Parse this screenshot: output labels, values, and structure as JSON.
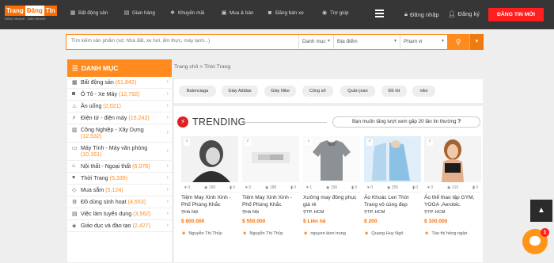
{
  "logo": {
    "part1": "Trang",
    "part2": "Đăng",
    "part3": "Tin",
    "tagline": "ĐĂNG NHANH - BÁN NHANH"
  },
  "nav": [
    {
      "label": "Bất động sản",
      "icon": "building-icon"
    },
    {
      "label": "Gian hàng",
      "icon": "store-icon"
    },
    {
      "label": "Khuyến mãi",
      "icon": "gift-icon"
    },
    {
      "label": "Mua & bán",
      "icon": "cart-icon"
    },
    {
      "label": "Đăng bán xe",
      "icon": "car-icon"
    },
    {
      "label": "Trợ giúp",
      "icon": "help-icon"
    }
  ],
  "account": {
    "login": "Đăng nhập",
    "register": "Đăng ký",
    "post_button": "ĐĂNG TIN MỚI"
  },
  "search": {
    "placeholder": "Tìm kiếm sản phẩm (vd: Nhà đất, xe hơi, ẩm thực, máy lạnh...)",
    "category": "Danh mục",
    "location": "Địa điểm",
    "range": "Phạm vi"
  },
  "sidebar": {
    "title": "DANH MỤC",
    "items": [
      {
        "label": "Bất động sản",
        "count": "(61,842)"
      },
      {
        "label": "Ô Tô - Xe Máy",
        "count": "(12,792)"
      },
      {
        "label": "Ăn uống",
        "count": "(2,021)"
      },
      {
        "label": "Điện tử - điện máy",
        "count": "(15,242)"
      },
      {
        "label": "Công Nghiệp - Xây Dựng",
        "count": "(12,532)"
      },
      {
        "label": "Máy Tính - Máy văn phòng",
        "count": "(10,161)"
      },
      {
        "label": "Nội thất - Ngoại thất",
        "count": "(6,076)"
      },
      {
        "label": "Thời Trang",
        "count": "(5,339)"
      },
      {
        "label": "Mua sắm",
        "count": "(5,124)"
      },
      {
        "label": "Đồ dùng sinh hoạt",
        "count": "(4,653)"
      },
      {
        "label": "Việc làm tuyển dụng",
        "count": "(3,562)"
      },
      {
        "label": "Giáo dục và đào tạo",
        "count": "(2,427)"
      }
    ]
  },
  "breadcrumb": {
    "home": "Trang chủ",
    "sep": ">",
    "current": "Thời Trang"
  },
  "tags": [
    "Balenciaga",
    "Giày Adidas",
    "Giày Nike",
    "Công sở",
    "Quần jean",
    "Đồ lót",
    "nike"
  ],
  "trending": {
    "title": "TRENDING",
    "promo": "Bạn muốn tăng lượt xem gấp 20 lần tin thường",
    "cards": [
      {
        "likes": "0",
        "views": "189",
        "shares": "0",
        "title": "Tiệm May Xinh Xinh - Phố Phùng Khắc",
        "location": "Hà Nội",
        "price": "$ 600.000",
        "author": "Nguyễn Thị Thủy"
      },
      {
        "likes": "0",
        "views": "188",
        "shares": "0",
        "title": "Tiệm May Xinh Xinh - Phố Phùng Khắc",
        "location": "Hà Nội",
        "price": "$ 550.000",
        "author": "Nguyễn Thị Thủy"
      },
      {
        "likes": "1",
        "views": "156",
        "shares": "0",
        "title": "Xưởng may đồng phục giá rẻ",
        "location": "TP. HCM",
        "price": "$ Liên hệ",
        "author": "nguyen kien trung"
      },
      {
        "likes": "0",
        "views": "255",
        "shares": "0",
        "title": "Áo Khoác Len Thời Trang vô cùng đẹp",
        "location": "TP. HCM",
        "price": "$ 200",
        "author": "Quang Huy Ngô"
      },
      {
        "likes": "0",
        "views": "215",
        "shares": "0",
        "title": "Áo thể thao tập GYM, YOGA ,Aerobic.",
        "location": "TP. HCM",
        "price": "$ 100.000",
        "author": "Tào thị hồng ngân"
      }
    ]
  },
  "chat": {
    "badge": "1"
  }
}
